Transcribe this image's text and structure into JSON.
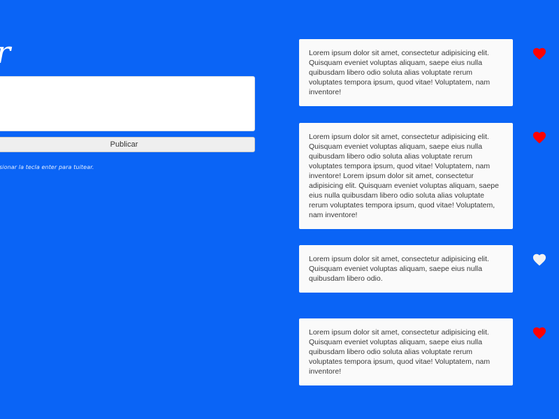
{
  "header": {
    "title_fragment": "r"
  },
  "composer": {
    "input_value": "",
    "input_placeholder": "",
    "publish_label": "Publicar",
    "hint": "esionar la tecla enter para tuitear."
  },
  "colors": {
    "background": "#0a64f6",
    "liked_heart": "#ff0000",
    "unliked_heart": "#f2f2f2"
  },
  "tweets": [
    {
      "text": "Lorem ipsum dolor sit amet, consectetur adipisicing elit. Quisquam eveniet voluptas aliquam, saepe eius nulla quibusdam libero odio soluta alias voluptate rerum voluptates tempora ipsum, quod vitae! Voluptatem, nam inventore!",
      "liked": true,
      "heart_icon": "heart-filled"
    },
    {
      "text": "Lorem ipsum dolor sit amet, consectetur adipisicing elit. Quisquam eveniet voluptas aliquam, saepe eius nulla quibusdam libero odio soluta alias voluptate rerum voluptates tempora ipsum, quod vitae! Voluptatem, nam inventore! Lorem ipsum dolor sit amet, consectetur adipisicing elit. Quisquam eveniet voluptas aliquam, saepe eius nulla quibusdam libero odio soluta alias voluptate rerum voluptates tempora ipsum, quod vitae! Voluptatem, nam inventore!",
      "liked": true,
      "heart_icon": "heart-filled"
    },
    {
      "text": "Lorem ipsum dolor sit amet, consectetur adipisicing elit. Quisquam eveniet voluptas aliquam, saepe eius nulla quibusdam libero odio.",
      "liked": false,
      "heart_icon": "heart-outline"
    },
    {
      "text": "Lorem ipsum dolor sit amet, consectetur adipisicing elit. Quisquam eveniet voluptas aliquam, saepe eius nulla quibusdam libero odio soluta alias voluptate rerum voluptates tempora ipsum, quod vitae! Voluptatem, nam inventore!",
      "liked": true,
      "heart_icon": "heart-filled"
    }
  ]
}
